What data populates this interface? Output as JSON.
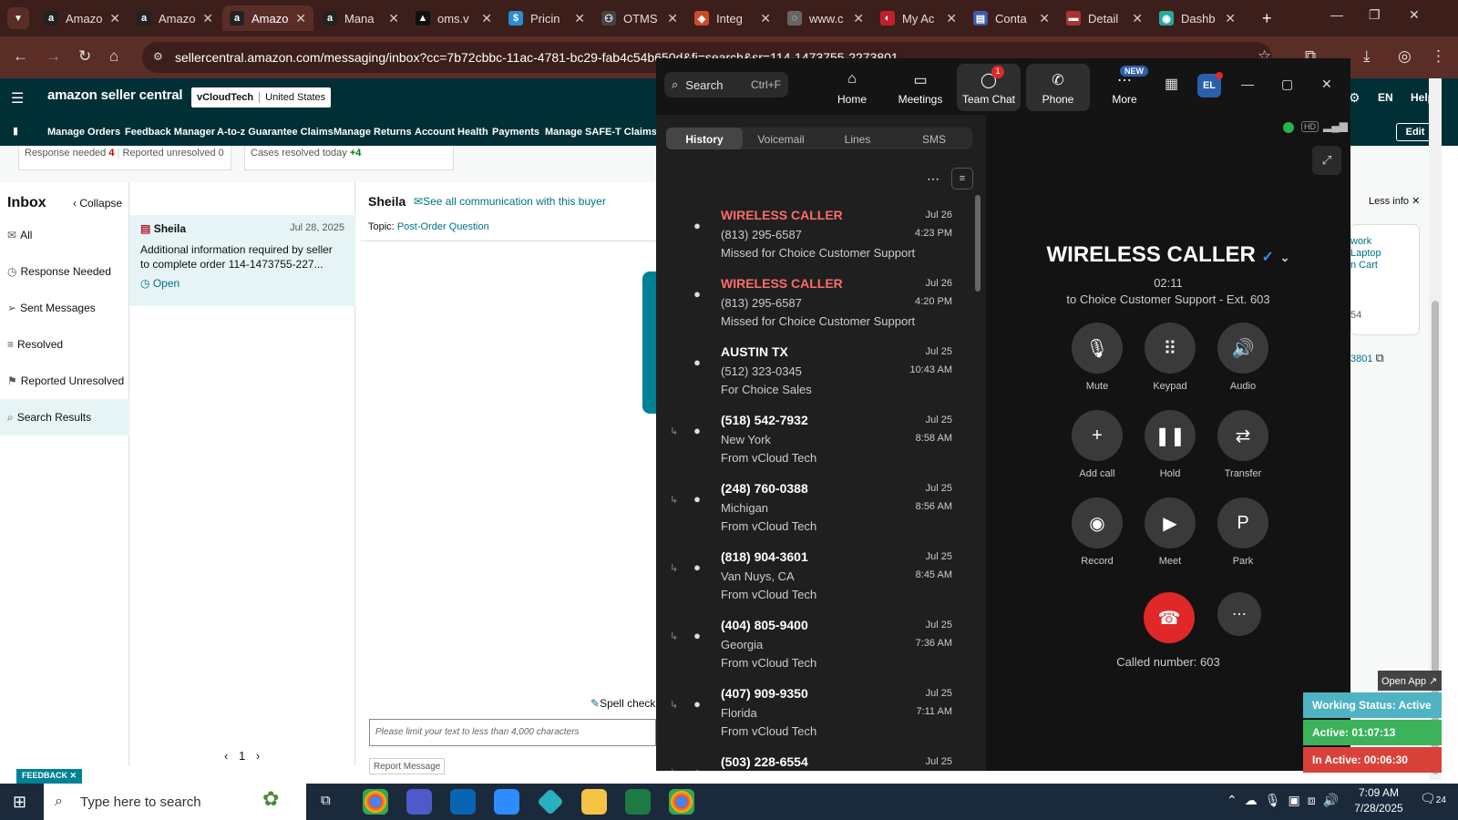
{
  "browser": {
    "tabs": [
      {
        "title": "Amazo",
        "favicon": "a",
        "color": "#222"
      },
      {
        "title": "Amazo",
        "favicon": "a",
        "color": "#222"
      },
      {
        "title": "Amazo",
        "favicon": "a",
        "color": "#222"
      },
      {
        "title": "Mana",
        "favicon": "a",
        "color": "#222"
      },
      {
        "title": "oms.v",
        "favicon": "▲",
        "color": "#111"
      },
      {
        "title": "Pricin",
        "favicon": "$",
        "color": "#2a8bd8"
      },
      {
        "title": "OTMS",
        "favicon": "⚇",
        "color": "#444"
      },
      {
        "title": "Integ",
        "favicon": "◈",
        "color": "#d04a2a"
      },
      {
        "title": "www.c",
        "favicon": "◌",
        "color": "#666"
      },
      {
        "title": "My Ac",
        "favicon": "◐",
        "color": "#c0202a"
      },
      {
        "title": "Conta",
        "favicon": "▤",
        "color": "#3b5ba8"
      },
      {
        "title": "Detail",
        "favicon": "▬",
        "color": "#a33"
      },
      {
        "title": "Dashb",
        "favicon": "◉",
        "color": "#2aa8a0"
      }
    ],
    "url": "sellercentral.amazon.com/messaging/inbox?cc=7b72cbbc-11ac-4781-bc29-fab4c54b650d&fi=search&sr=114-1473755-2273801"
  },
  "amazon": {
    "logo": "amazon seller central",
    "account_name": "vCloudTech",
    "account_region": "United States",
    "lang": "EN",
    "help": "Help",
    "nav": [
      "Manage Orders",
      "Feedback Manager",
      "A-to-z Guarantee Claims",
      "Manage Returns",
      "Account Health",
      "Payments",
      "Manage SAFE-T Claims"
    ],
    "edit": "Edit",
    "card1": {
      "label1": "Response needed",
      "val1": "4",
      "label2": "Reported unresolved",
      "val2": "0"
    },
    "card2": {
      "label": "Cases resolved today",
      "val": "+4"
    },
    "inbox_title": "Inbox",
    "collapse": "Collapse",
    "side_items": [
      "All",
      "Response Needed",
      "Sent Messages",
      "Resolved",
      "Reported Unresolved",
      "Search Results"
    ],
    "thread": {
      "name": "Sheila",
      "date": "Jul 28, 2025",
      "preview": "Additional information required by seller to complete order 114-1473755-227...",
      "status": "Open"
    },
    "msg_header": {
      "name": "Sheila",
      "link": "See all communication with this buyer",
      "topic_label": "Topic:",
      "topic": "Post-Order Question"
    },
    "spell_check": "Spell check",
    "reply_placeholder": "Please limit your text to less than 4,000 characters",
    "report_message": "Report Message",
    "page": "1",
    "feedback": "FEEDBACK",
    "less_info": "Less info",
    "right_items": [
      "work",
      "Laptop",
      "n Cart",
      "54",
      "3801"
    ]
  },
  "zoom": {
    "search": "Search",
    "search_shortcut": "Ctrl+F",
    "top_buttons": [
      {
        "label": "Home",
        "icon": "⌂"
      },
      {
        "label": "Meetings",
        "icon": "▭"
      },
      {
        "label": "Team Chat",
        "icon": "◯",
        "badge": "1"
      },
      {
        "label": "Phone",
        "icon": "✆"
      },
      {
        "label": "More",
        "icon": "⋯",
        "badge": "NEW"
      }
    ],
    "avatar_initials": "EL",
    "tabs": [
      "History",
      "Voicemail",
      "Lines",
      "SMS"
    ],
    "calls": [
      {
        "name": "WIRELESS CALLER",
        "line2": "(813) 295-6587",
        "line3": "Missed for Choice Customer Support",
        "date": "Jul 26",
        "time": "4:23 PM",
        "missed": true,
        "fwd": false
      },
      {
        "name": "WIRELESS CALLER",
        "line2": "(813) 295-6587",
        "line3": "Missed for Choice Customer Support",
        "date": "Jul 26",
        "time": "4:20 PM",
        "missed": true,
        "fwd": false
      },
      {
        "name": "AUSTIN TX",
        "line2": "(512) 323-0345",
        "line3": "For Choice Sales",
        "date": "Jul 25",
        "time": "10:43 AM",
        "missed": false,
        "fwd": false
      },
      {
        "name": "(518) 542-7932",
        "line2": "New York",
        "line3": "From vCloud Tech",
        "date": "Jul 25",
        "time": "8:58 AM",
        "missed": false,
        "fwd": true
      },
      {
        "name": "(248) 760-0388",
        "line2": "Michigan",
        "line3": "From vCloud Tech",
        "date": "Jul 25",
        "time": "8:56 AM",
        "missed": false,
        "fwd": true
      },
      {
        "name": "(818) 904-3601",
        "line2": "Van Nuys, CA",
        "line3": "From vCloud Tech",
        "date": "Jul 25",
        "time": "8:45 AM",
        "missed": false,
        "fwd": true
      },
      {
        "name": "(404) 805-9400",
        "line2": "Georgia",
        "line3": "From vCloud Tech",
        "date": "Jul 25",
        "time": "7:36 AM",
        "missed": false,
        "fwd": true
      },
      {
        "name": "(407) 909-9350",
        "line2": "Florida",
        "line3": "From vCloud Tech",
        "date": "Jul 25",
        "time": "7:11 AM",
        "missed": false,
        "fwd": true
      },
      {
        "name": "(503) 228-6554",
        "line2": "",
        "line3": "",
        "date": "Jul 25",
        "time": "",
        "missed": false,
        "fwd": true
      }
    ],
    "active_call": {
      "caller": "WIRELESS CALLER",
      "duration": "02:11",
      "to": "to Choice Customer Support - Ext. 603",
      "called_number": "Called number: 603"
    },
    "controls": [
      {
        "label": "Mute",
        "icon": "🎙"
      },
      {
        "label": "Keypad",
        "icon": "⠿"
      },
      {
        "label": "Audio",
        "icon": "🔊"
      },
      {
        "label": "Add call",
        "icon": "+"
      },
      {
        "label": "Hold",
        "icon": "❚❚"
      },
      {
        "label": "Transfer",
        "icon": "⇄"
      },
      {
        "label": "Record",
        "icon": "◉"
      },
      {
        "label": "Meet",
        "icon": "▶"
      },
      {
        "label": "Park",
        "icon": "P"
      }
    ]
  },
  "status": {
    "open_app": "Open App",
    "working": "Working Status: Active",
    "active": "Active: 01:07:13",
    "inactive": "In Active: 00:06:30"
  },
  "taskbar": {
    "search": "Type here to search",
    "time": "7:09 AM",
    "date": "7/28/2025",
    "notif_count": "24"
  },
  "colors": {
    "browser_frame": "#3c1f1b",
    "amazon_header": "#002f36",
    "missed": "#ff6b6b",
    "hangup": "#e02828",
    "status_working": "#4fb3c4",
    "status_active": "#3cb35a",
    "status_inactive": "#d9423a"
  }
}
